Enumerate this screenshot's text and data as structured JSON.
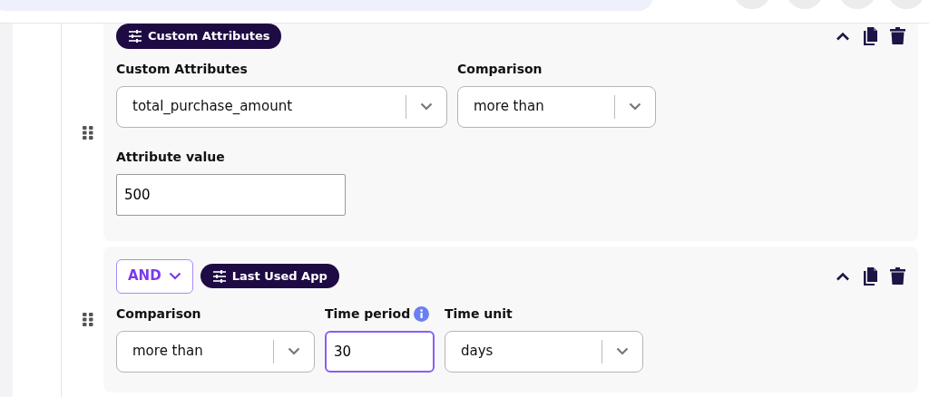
{
  "conditions": [
    {
      "chip": "Custom Attributes",
      "fields": [
        {
          "kind": "select",
          "label": "Custom Attributes",
          "value": "total_purchase_amount",
          "focused": false
        },
        {
          "kind": "select",
          "label": "Comparison",
          "value": "more than",
          "focused": false
        },
        {
          "kind": "break"
        },
        {
          "kind": "input",
          "label": "Attribute value",
          "value": "500",
          "focused": false
        }
      ]
    },
    {
      "operator": "AND",
      "chip": "Last Used App",
      "fields": [
        {
          "kind": "select",
          "label": "Comparison",
          "value": "more than",
          "focused": false
        },
        {
          "kind": "input",
          "label": "Time period",
          "value": "30",
          "focused": true,
          "info": true
        },
        {
          "kind": "select",
          "label": "Time unit",
          "value": "days",
          "focused": false
        }
      ]
    }
  ]
}
